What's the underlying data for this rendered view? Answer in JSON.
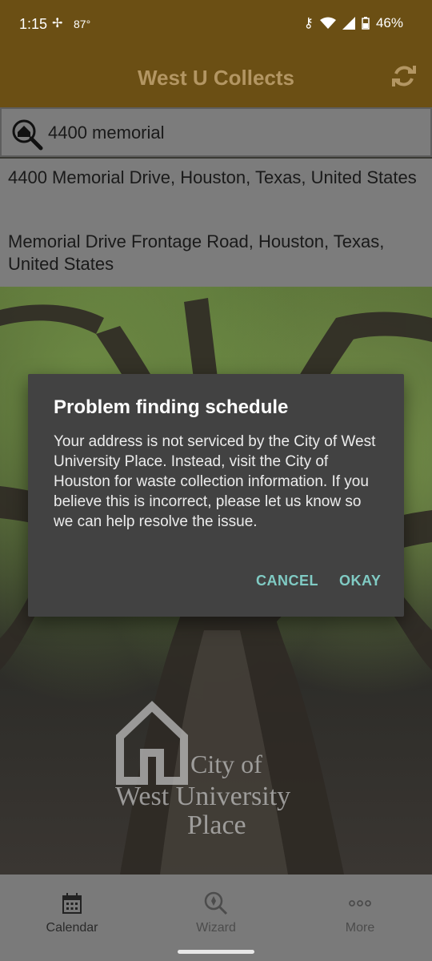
{
  "status_bar": {
    "time": "1:15",
    "temp": "87°",
    "battery": "46%"
  },
  "header": {
    "title": "West U Collects"
  },
  "search": {
    "value": "4400 memorial"
  },
  "suggestions": [
    {
      "text": "4400 Memorial Drive, Houston, Texas, United States"
    },
    {
      "text": "Memorial Drive Frontage Road, Houston, Texas, United States"
    }
  ],
  "logo": {
    "city": "City of",
    "west": "West University",
    "place": "Place"
  },
  "dialog": {
    "title": "Problem finding schedule",
    "message": "Your address is not serviced by the City of West University Place. Instead, visit the City of Houston for waste collection information. If you believe this is incorrect, please let us know so we can help resolve the issue.",
    "cancel_label": "CANCEL",
    "okay_label": "OKAY",
    "accent_color": "#80cbc4"
  },
  "bottom_nav": {
    "tabs": [
      {
        "label": "Calendar",
        "icon": "calendar-icon"
      },
      {
        "label": "Wizard",
        "icon": "wizard-icon"
      },
      {
        "label": "More",
        "icon": "more-icon"
      }
    ]
  }
}
